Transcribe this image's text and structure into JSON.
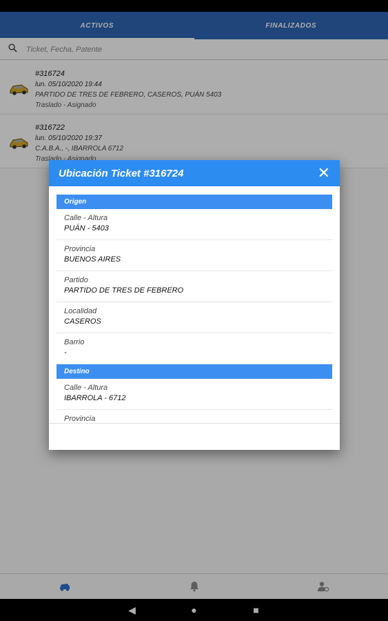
{
  "tabs": [
    {
      "label": "ACTIVOS"
    },
    {
      "label": "FINALIZADOS"
    }
  ],
  "search": {
    "placeholder": "Ticket, Fecha, Patente"
  },
  "tickets": [
    {
      "number": "#316724",
      "date": "lun. 05/10/2020 19:44",
      "address": "PARTIDO DE TRES DE FEBRERO, CASEROS, PUÁN 5403",
      "status": "Traslado - Asignado"
    },
    {
      "number": "#316722",
      "date": "lun. 05/10/2020 19:37",
      "address": "C.A.B.A., -, IBARROLA 6712",
      "status": "Traslado - Asignado"
    }
  ],
  "modal": {
    "title": "Ubicación Ticket #316724",
    "close": "✕",
    "origen": {
      "heading": "Origen",
      "fields": [
        {
          "label": "Calle - Altura",
          "value": "PUÁN - 5403"
        },
        {
          "label": "Provincia",
          "value": "BUENOS AIRES"
        },
        {
          "label": "Partido",
          "value": "PARTIDO DE TRES DE FEBRERO"
        },
        {
          "label": "Localidad",
          "value": "CASEROS"
        },
        {
          "label": "Barrio",
          "value": "-"
        }
      ]
    },
    "destino": {
      "heading": "Destino",
      "fields": [
        {
          "label": "Calle - Altura",
          "value": "IBARROLA - 6712"
        },
        {
          "label": "Provincia",
          "value": ""
        }
      ]
    }
  },
  "colors": {
    "primary": "#2f66b6",
    "accent": "#2d8cf0"
  },
  "icons": {
    "search": "search-icon",
    "car": "car-icon",
    "bell": "bell-icon",
    "profile": "profile-icon",
    "close": "close-icon"
  }
}
